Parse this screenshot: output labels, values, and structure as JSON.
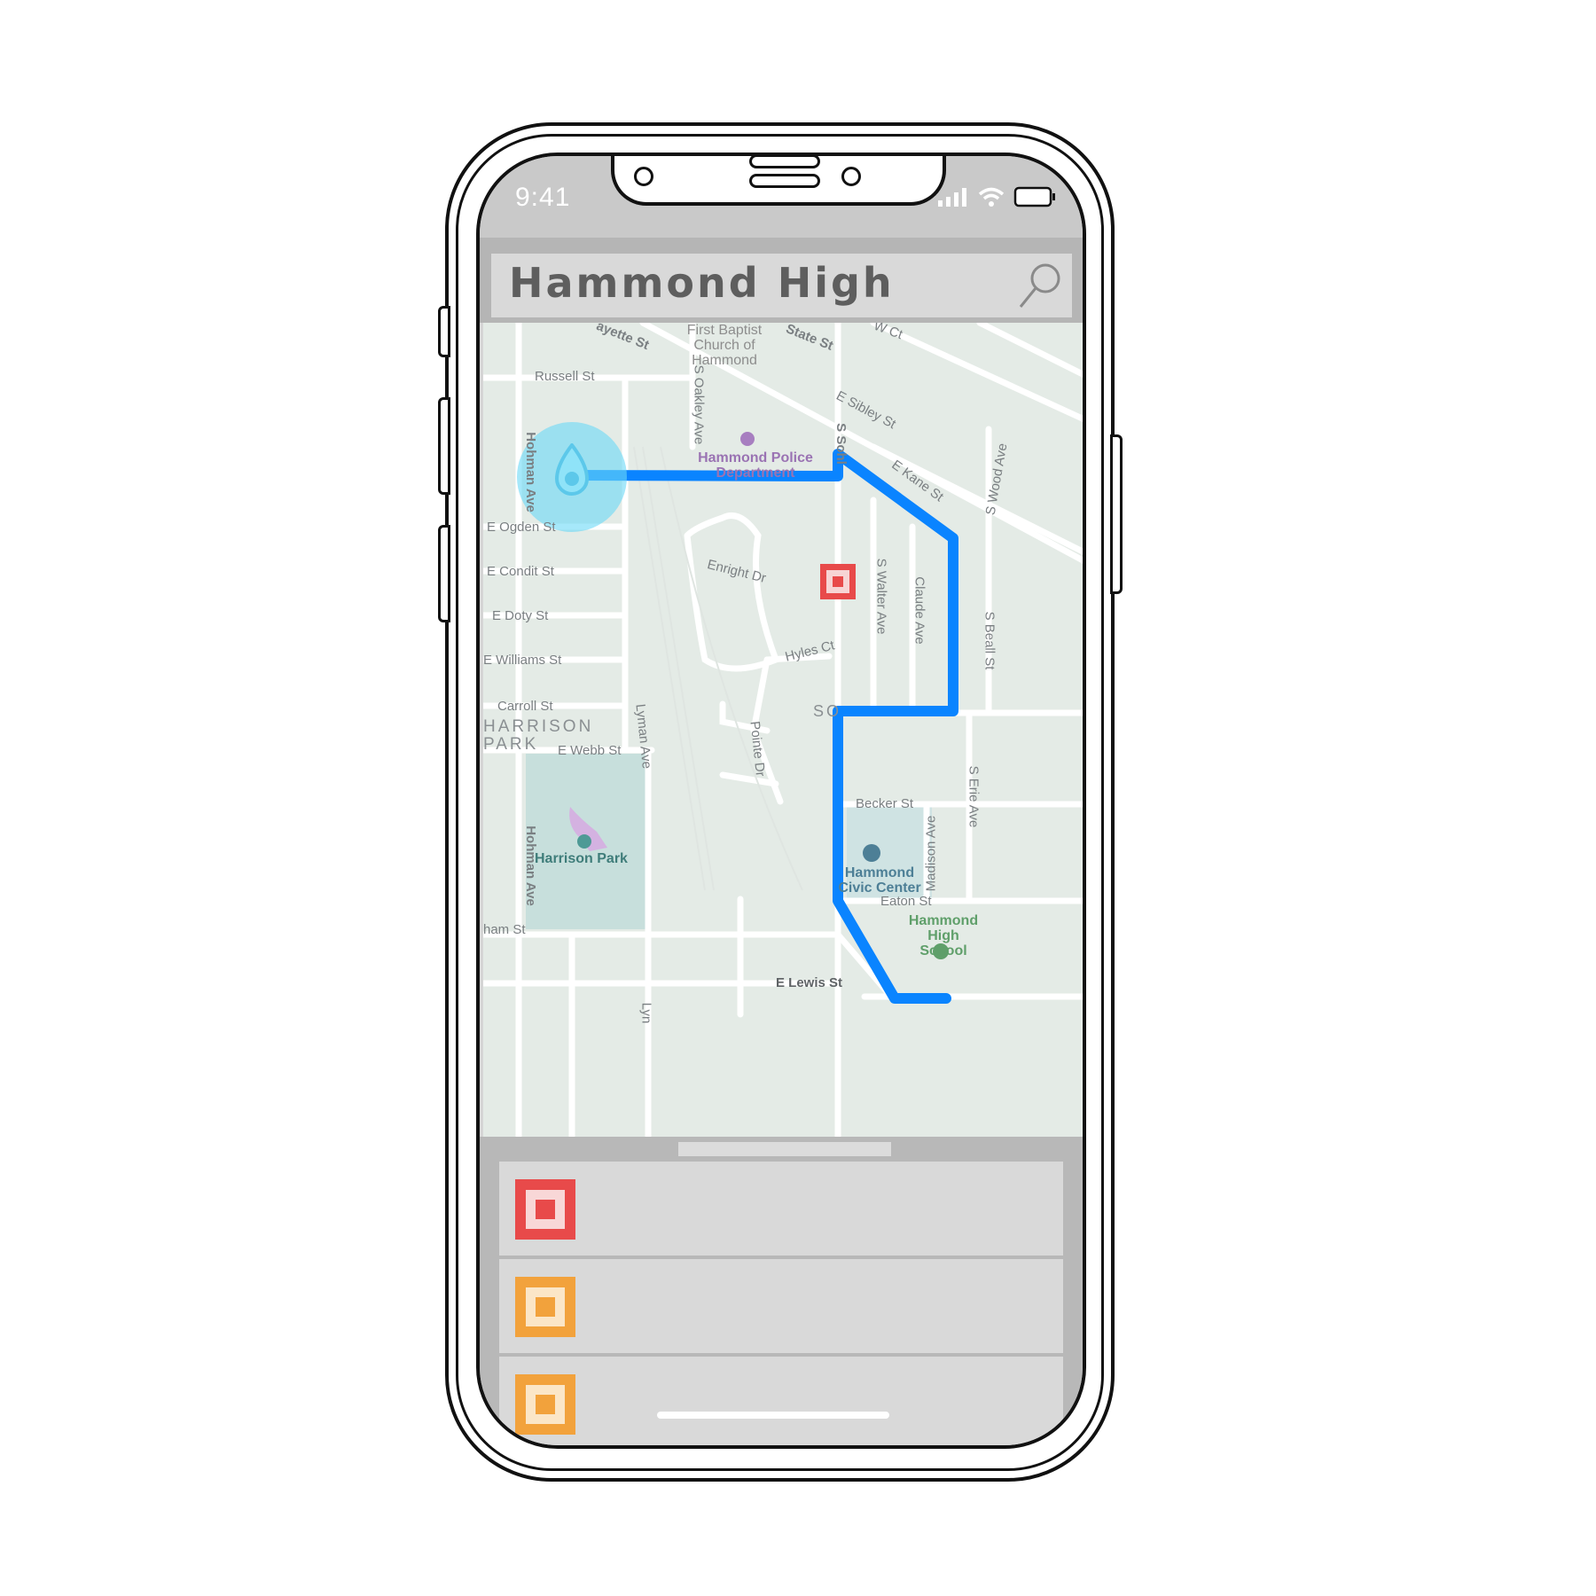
{
  "status_bar": {
    "time": "9:41"
  },
  "search": {
    "query": "Hammond High",
    "icon": "search-icon"
  },
  "map": {
    "streets": [
      "Russell St",
      "ayette St",
      "State St",
      "W Ct",
      "E Sibley St",
      "E Kane St",
      "S Wood Ave",
      "S Oakley Ave",
      "S Sohl",
      "Hohman Ave",
      "E Ogden St",
      "E Condit St",
      "E Doty St",
      "E Williams St",
      "Carroll St",
      "E Webb St",
      "Enright Dr",
      "Hyles Ct",
      "S Walter Ave",
      "Claude Ave",
      "S Beall St",
      "Lyman Ave",
      "Pointe Dr",
      "S Erie Ave",
      "Becker St",
      "Madison Ave",
      "Eaton St",
      "E Lewis St",
      "Hohman Ave",
      "ham St",
      "Lyn"
    ],
    "places": {
      "church": "First Baptist Church of Hammond",
      "police": "Hammond Police Department",
      "park_area": "HARRISON PARK",
      "park": "Harrison Park",
      "civic_center": "Hammond Civic Center",
      "school": "Hammond High School",
      "so_fragment": "SO"
    },
    "route_color": "#0a84ff",
    "marker_color": "#e84a4a"
  },
  "sheet": {
    "items": [
      {
        "color": "#e84a4a"
      },
      {
        "color": "#f2a23c"
      },
      {
        "color": "#f2a23c"
      }
    ]
  }
}
